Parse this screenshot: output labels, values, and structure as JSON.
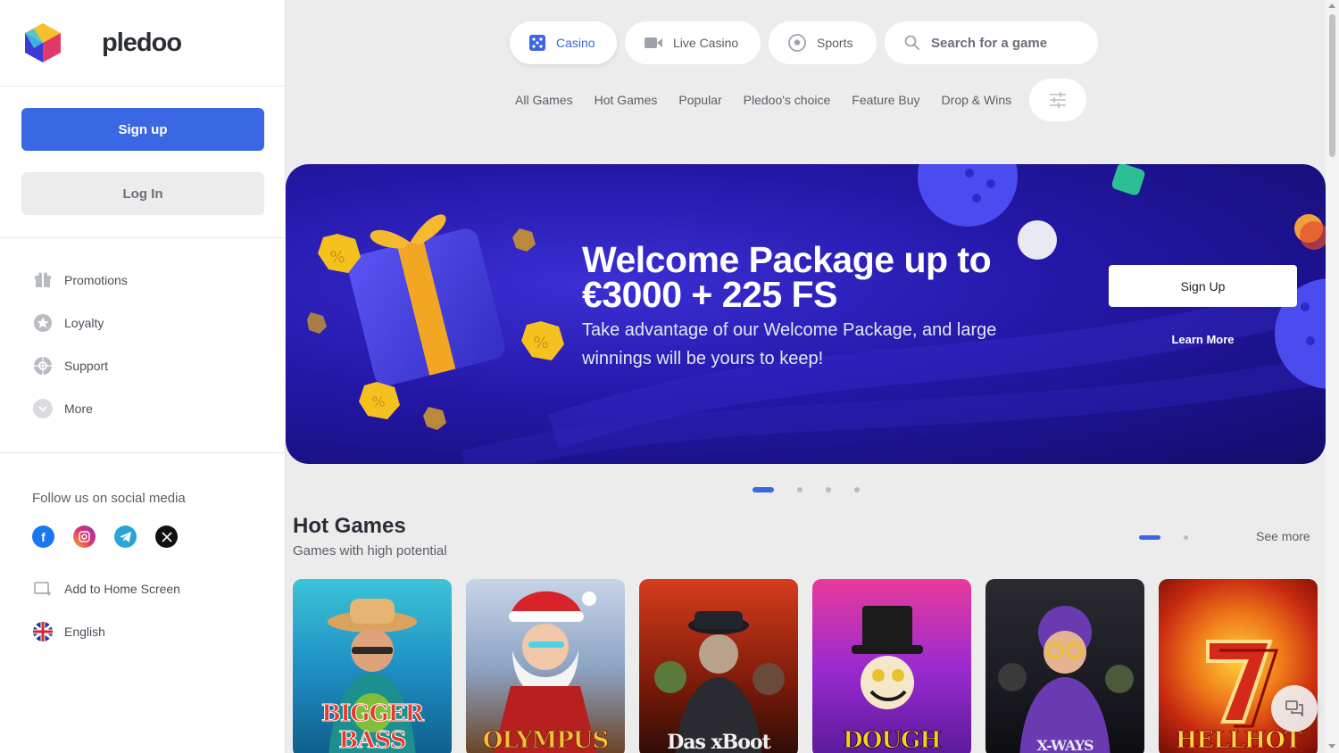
{
  "brand": {
    "name": "pledoo"
  },
  "auth": {
    "signup_label": "Sign up",
    "login_label": "Log In"
  },
  "sidebar": {
    "items": [
      {
        "label": "Promotions",
        "icon": "gift-icon"
      },
      {
        "label": "Loyalty",
        "icon": "star-icon"
      },
      {
        "label": "Support",
        "icon": "lifebuoy-icon"
      },
      {
        "label": "More",
        "icon": "chevron-down-icon"
      }
    ],
    "social_title": "Follow us on social media",
    "social": [
      "facebook-icon",
      "instagram-icon",
      "telegram-icon",
      "x-icon"
    ],
    "add_home_label": "Add to Home Screen",
    "language_label": "English"
  },
  "topnav": {
    "casino_label": "Casino",
    "live_label": "Live Casino",
    "sports_label": "Sports",
    "search_placeholder": "Search for a game"
  },
  "subnav": {
    "tabs": [
      "All Games",
      "Hot Games",
      "Popular",
      "Pledoo's choice",
      "Feature Buy",
      "Drop & Wins"
    ]
  },
  "banner": {
    "title": "Welcome Package up to €3000 + 225 FS",
    "subtitle": "Take advantage of our Welcome Package, and large winnings will be yours to keep!",
    "cta_label": "Sign Up",
    "learn_label": "Learn More",
    "slides_total": 4,
    "slide_active": 1
  },
  "hot_games": {
    "title": "Hot Games",
    "subtitle": "Games with high potential",
    "see_more_label": "See more",
    "games": [
      {
        "title": "BIGGER BASS"
      },
      {
        "title": "OLYMPUS"
      },
      {
        "title": "Das xBoot"
      },
      {
        "title": "DOUGH"
      },
      {
        "title": "X-WAYS"
      },
      {
        "title": "HELLHOT"
      }
    ]
  },
  "colors": {
    "accent": "#3a67e3",
    "banner": "#2417a8"
  }
}
